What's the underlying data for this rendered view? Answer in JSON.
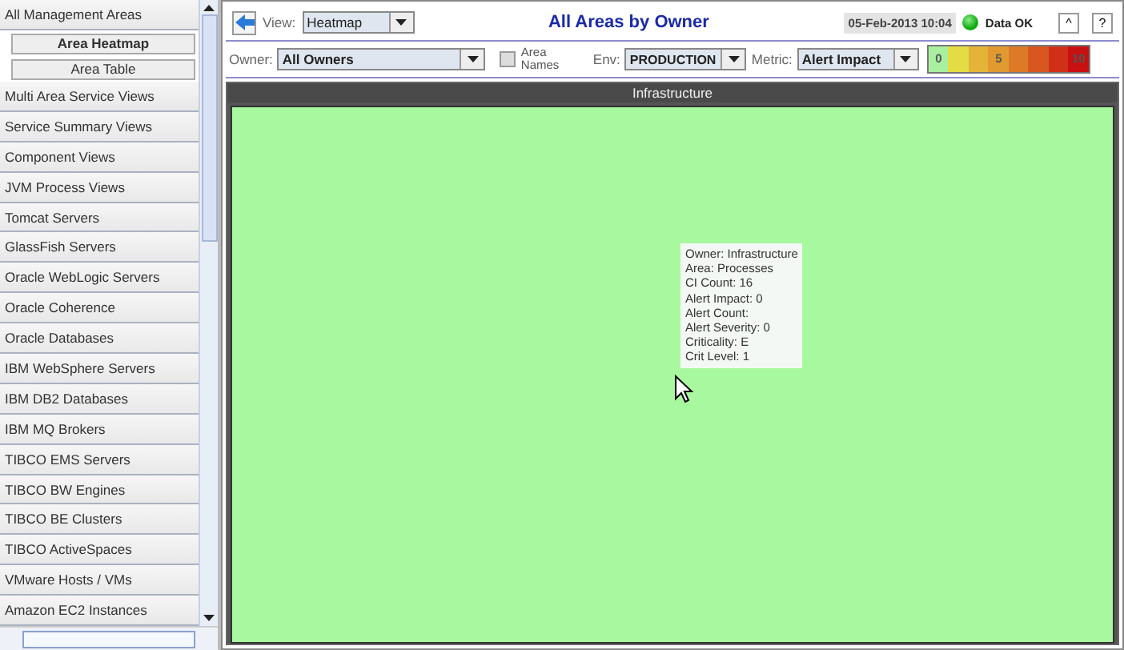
{
  "sidebar": {
    "header": "All Management Areas",
    "subitems": [
      {
        "label": "Area Heatmap",
        "selected": true
      },
      {
        "label": "Area Table",
        "selected": false
      }
    ],
    "items": [
      "Multi Area Service Views",
      "Service Summary Views",
      "Component Views",
      "JVM Process Views",
      "Tomcat Servers",
      "GlassFish Servers",
      "Oracle WebLogic Servers",
      "Oracle Coherence",
      "Oracle Databases",
      "IBM WebSphere Servers",
      "IBM DB2 Databases",
      "IBM MQ Brokers",
      "TIBCO EMS Servers",
      "TIBCO BW Engines",
      "TIBCO BE Clusters",
      "TIBCO ActiveSpaces",
      "VMware Hosts / VMs",
      "Amazon EC2 Instances"
    ]
  },
  "toolbar": {
    "view_label": "View:",
    "view_value": "Heatmap",
    "title": "All Areas by Owner",
    "timestamp": "05-Feb-2013 10:04",
    "status": "Data OK",
    "buttons": [
      "^",
      "?"
    ]
  },
  "filters": {
    "owner_label": "Owner:",
    "owner_value": "All Owners",
    "area_names_label": "Area Names",
    "area_names_checked": false,
    "env_label": "Env:",
    "env_value": "PRODUCTION",
    "metric_label": "Metric:",
    "metric_value": "Alert Impact",
    "legend": [
      {
        "color": "#a8f0a0",
        "label": "0"
      },
      {
        "color": "#e4dc44"
      },
      {
        "color": "#e4b438"
      },
      {
        "color": "#e09a30",
        "label": "5"
      },
      {
        "color": "#dc7a28"
      },
      {
        "color": "#d85620"
      },
      {
        "color": "#d03018"
      },
      {
        "color": "#c81010",
        "label": "10"
      }
    ]
  },
  "heatmap": {
    "title": "Infrastructure",
    "cells": [
      {
        "color": "#a8f8a0"
      }
    ],
    "tooltip": [
      "Owner: Infrastructure",
      "Area: Processes",
      "CI Count: 16",
      "Alert Impact: 0",
      "Alert Count:",
      "Alert Severity: 0",
      "Criticality: E",
      "Crit Level: 1"
    ]
  }
}
